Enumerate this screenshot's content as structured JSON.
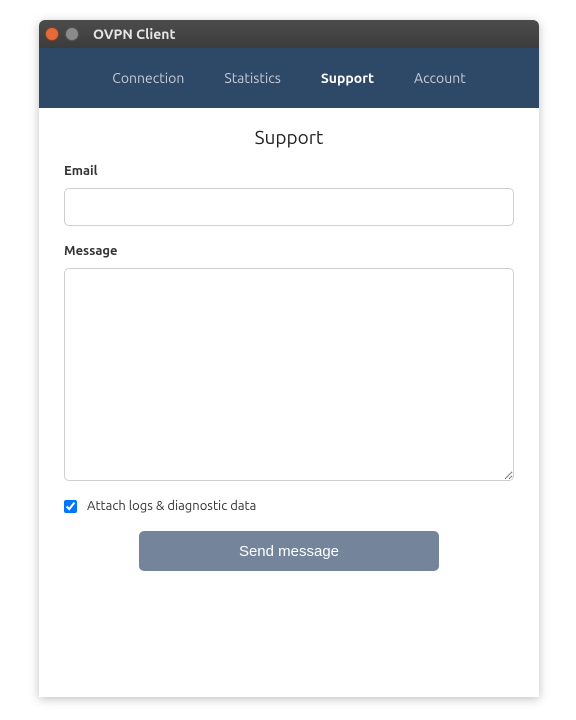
{
  "window": {
    "title": "OVPN Client"
  },
  "nav": {
    "items": [
      {
        "label": "Connection",
        "active": false
      },
      {
        "label": "Statistics",
        "active": false
      },
      {
        "label": "Support",
        "active": true
      },
      {
        "label": "Account",
        "active": false
      }
    ]
  },
  "page": {
    "title": "Support",
    "email_label": "Email",
    "email_value": "",
    "message_label": "Message",
    "message_value": "",
    "attach_label": "Attach logs & diagnostic data",
    "attach_checked": true,
    "send_label": "Send message"
  }
}
